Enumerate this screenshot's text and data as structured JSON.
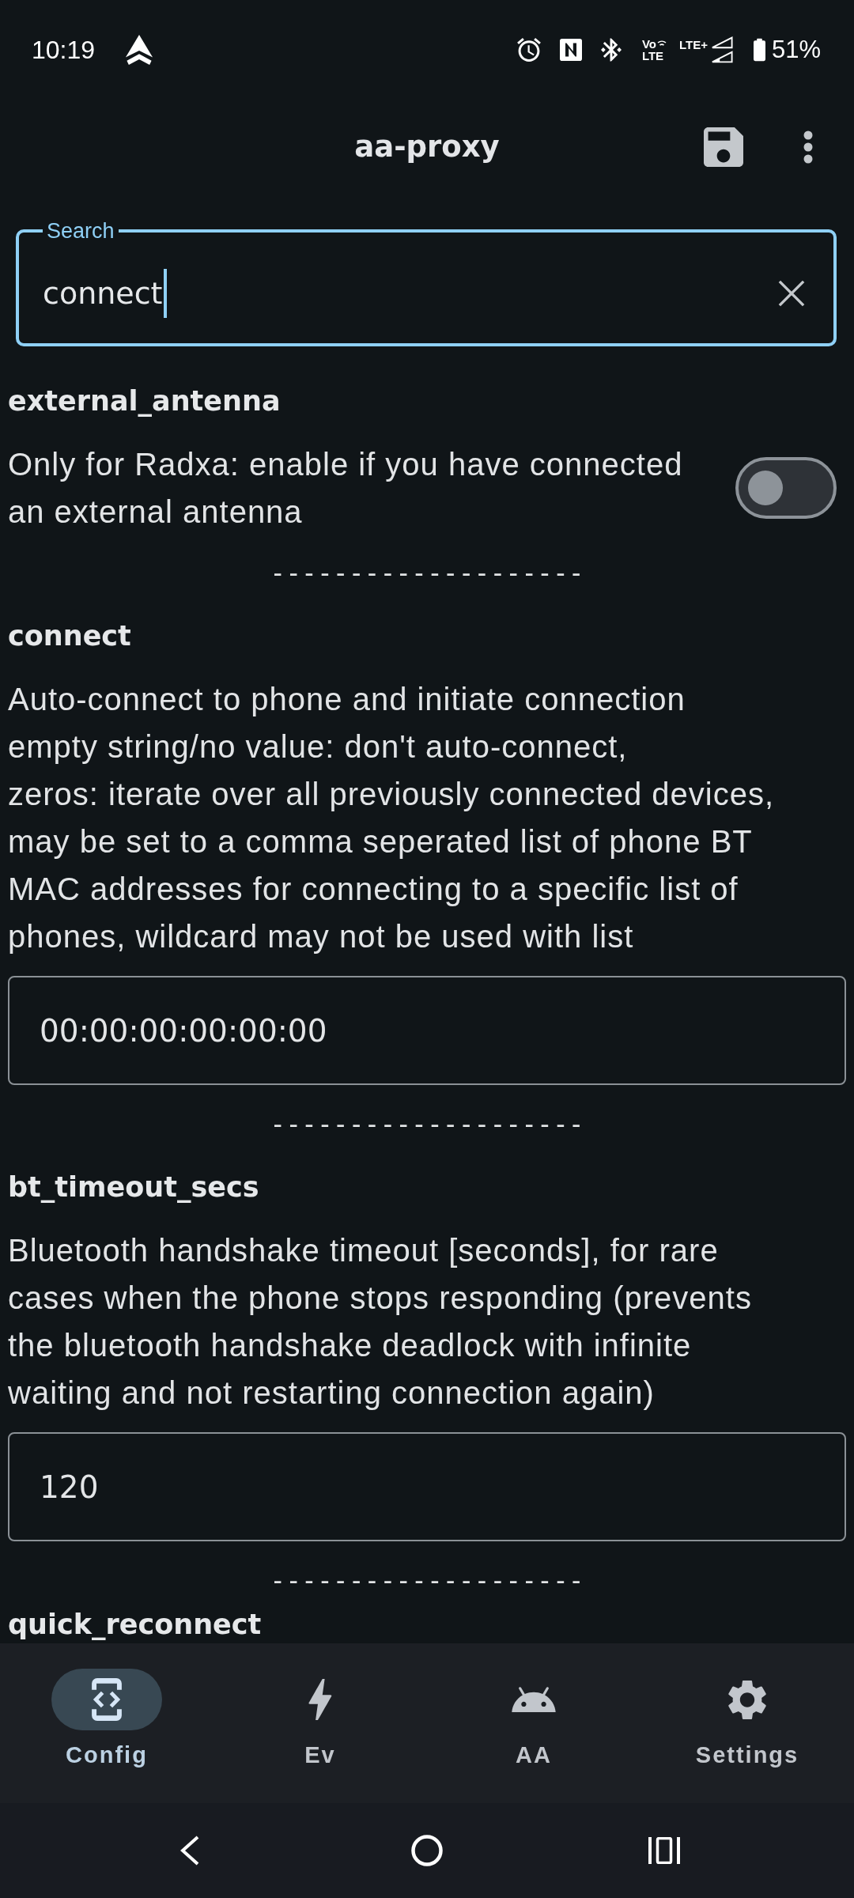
{
  "status_bar": {
    "time": "10:19",
    "volte": [
      "Vo",
      "LTE"
    ],
    "network": "LTE+",
    "battery": "51%"
  },
  "app_bar": {
    "title": "aa-proxy"
  },
  "search": {
    "label": "Search",
    "value": "connect",
    "focused": true
  },
  "settings": [
    {
      "kind": "toggle",
      "name": "external_antenna",
      "description": "Only for Radxa: enable if you have connected\nan external antenna",
      "on": false,
      "separator": "--------------------"
    },
    {
      "kind": "text",
      "name": "connect",
      "description": "Auto-connect to phone and initiate connection\nempty string/no value: don't auto-connect,\nzeros: iterate over all previously connected devices,\nmay be set to a comma seperated list of phone BT\nMAC addresses for connecting to a specific list of\nphones, wildcard may not be used with list",
      "value": "00:00:00:00:00:00",
      "separator": "--------------------"
    },
    {
      "kind": "text",
      "name": "bt_timeout_secs",
      "description": "Bluetooth handshake timeout [seconds], for rare\ncases when the phone stops responding (prevents\nthe bluetooth handshake deadlock with infinite\nwaiting and not restarting connection again)",
      "value": "120",
      "separator": "--------------------"
    },
    {
      "kind": "header",
      "name": "quick_reconnect"
    }
  ],
  "bottom_nav": [
    {
      "label": "Config",
      "selected": true
    },
    {
      "label": "Ev",
      "selected": false
    },
    {
      "label": "AA",
      "selected": false
    },
    {
      "label": "Settings",
      "selected": false
    }
  ]
}
